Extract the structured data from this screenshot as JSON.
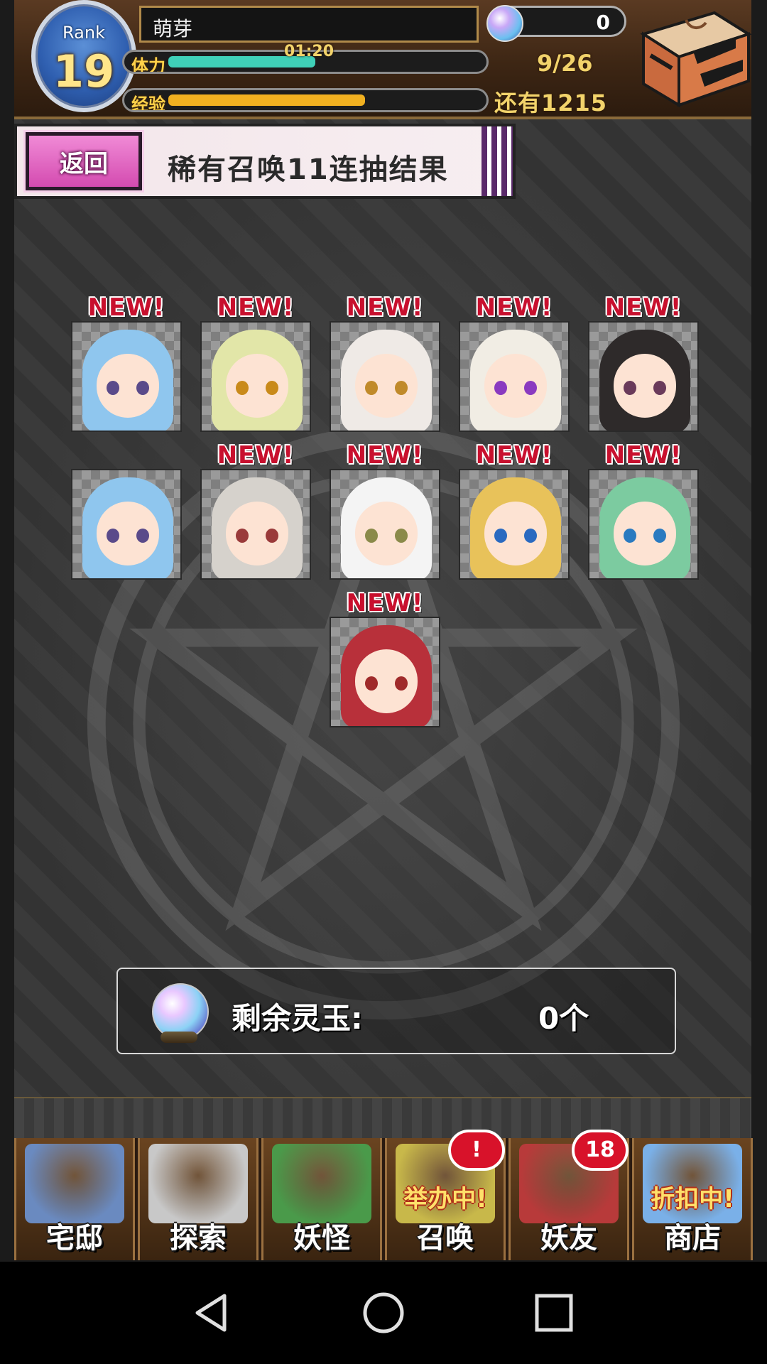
{
  "header": {
    "rank_label": "Rank",
    "rank_value": "19",
    "player_name": "萌芽",
    "stamina_label": "体力",
    "stamina_timer": "01:20",
    "stamina_count": "9/26",
    "stamina_level": 0.47,
    "exp_label": "经验",
    "exp_remaining": "还有1215",
    "exp_level": 0.63,
    "orb_count": "0"
  },
  "banner": {
    "back_label": "返回",
    "title": "稀有召唤11连抽结果"
  },
  "results": {
    "new_label": "NEW!",
    "cards": [
      {
        "id": "c1",
        "new": true,
        "hair": "#8fc6ee",
        "eye": "#5a4a8a"
      },
      {
        "id": "c2",
        "new": true,
        "hair": "#e2e6a8",
        "eye": "#c98a1a"
      },
      {
        "id": "c3",
        "new": true,
        "hair": "#efeae6",
        "eye": "#c08a2a"
      },
      {
        "id": "c4",
        "new": true,
        "hair": "#f1ede4",
        "eye": "#8a3ac0"
      },
      {
        "id": "c5",
        "new": true,
        "hair": "#2e2a2a",
        "eye": "#6a3a5a"
      },
      {
        "id": "c6",
        "new": false,
        "hair": "#8fc6ee",
        "eye": "#5a4a8a"
      },
      {
        "id": "c7",
        "new": true,
        "hair": "#d6d2cc",
        "eye": "#9a3a3a"
      },
      {
        "id": "c8",
        "new": true,
        "hair": "#f4f4f4",
        "eye": "#8a8a4a"
      },
      {
        "id": "c9",
        "new": true,
        "hair": "#e8c25a",
        "eye": "#2a6ac0"
      },
      {
        "id": "c10",
        "new": true,
        "hair": "#7ccba0",
        "eye": "#2a7ac0"
      },
      {
        "id": "c11",
        "new": true,
        "hair": "#b8303a",
        "eye": "#a02a2a"
      }
    ]
  },
  "remaining": {
    "label": "剩余灵玉:",
    "value": "0个"
  },
  "nav": {
    "items": [
      {
        "id": "home",
        "label": "宅邸",
        "color": "#6a8ac0"
      },
      {
        "id": "explore",
        "label": "探索",
        "color": "#c8c8c8"
      },
      {
        "id": "yokai",
        "label": "妖怪",
        "color": "#4a9a4a"
      },
      {
        "id": "summon",
        "label": "召唤",
        "color": "#c8b84a",
        "sub": "举办中!",
        "badge": "!"
      },
      {
        "id": "friends",
        "label": "妖友",
        "color": "#b83a3a",
        "badge": "18"
      },
      {
        "id": "shop",
        "label": "商店",
        "color": "#7ab0e8",
        "sub": "折扣中!"
      }
    ]
  },
  "colors": {
    "stamina_fill": "#3fd0b8",
    "exp_fill": "#f0b020",
    "back_button": "#e05cc0",
    "new_tag": "#c8102e",
    "badge": "#d8122a"
  },
  "system_bar": {
    "icons": [
      "back-triangle-icon",
      "home-circle-icon",
      "recents-square-icon"
    ]
  }
}
